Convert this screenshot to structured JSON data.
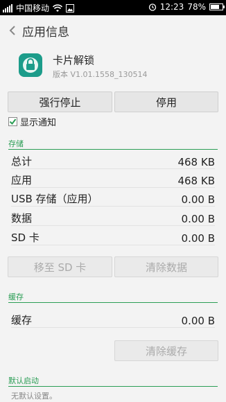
{
  "status_bar": {
    "carrier": "中国移动",
    "time": "12:23",
    "battery": "78%",
    "battery_level": 0.78
  },
  "header": {
    "title": "应用信息"
  },
  "app": {
    "name": "卡片解锁",
    "version": "版本 V1.01.1558_130514",
    "icon": "lock-icon"
  },
  "buttons": {
    "force_stop": "强行停止",
    "disable": "停用",
    "move_to_sd": "移至 SD 卡",
    "clear_data": "清除数据",
    "clear_cache": "清除缓存"
  },
  "notification": {
    "label": "显示通知",
    "checked": true
  },
  "storage": {
    "header": "存储",
    "rows": [
      {
        "label": "总计",
        "value": "468 KB"
      },
      {
        "label": "应用",
        "value": "468 KB"
      },
      {
        "label": "USB 存储（应用）",
        "value": "0.00 B"
      },
      {
        "label": "数据",
        "value": "0.00 B"
      },
      {
        "label": "SD 卡",
        "value": "0.00 B"
      }
    ]
  },
  "cache": {
    "header": "缓存",
    "label": "缓存",
    "value": "0.00 B"
  },
  "launch": {
    "header": "默认启动",
    "text": "无默认设置。"
  },
  "colors": {
    "accent": "#2a9d54",
    "app_icon_bg": "#1c9c8a"
  }
}
